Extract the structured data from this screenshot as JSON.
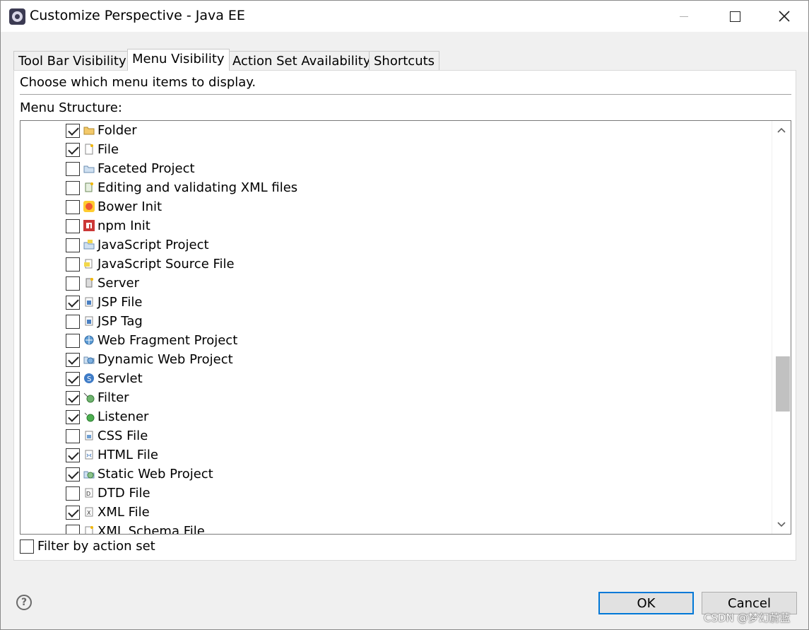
{
  "window": {
    "title": "Customize Perspective - Java EE"
  },
  "tabs": [
    {
      "label": "Tool Bar Visibility",
      "active": false
    },
    {
      "label": "Menu Visibility",
      "active": true
    },
    {
      "label": "Action Set Availability",
      "active": false
    },
    {
      "label": "Shortcuts",
      "active": false
    }
  ],
  "panel": {
    "instructions": "Choose which menu items to display.",
    "tree_label": "Menu Structure:"
  },
  "tree_items": [
    {
      "label": "Folder",
      "checked": true,
      "icon": "folder-icon"
    },
    {
      "label": "File",
      "checked": true,
      "icon": "file-icon"
    },
    {
      "label": "Faceted Project",
      "checked": false,
      "icon": "faceted-project-icon"
    },
    {
      "label": "Editing and validating XML files",
      "checked": false,
      "icon": "xml-project-icon"
    },
    {
      "label": "Bower Init",
      "checked": false,
      "icon": "bower-icon"
    },
    {
      "label": "npm Init",
      "checked": false,
      "icon": "npm-icon"
    },
    {
      "label": "JavaScript Project",
      "checked": false,
      "icon": "javascript-project-icon"
    },
    {
      "label": "JavaScript Source File",
      "checked": false,
      "icon": "javascript-file-icon"
    },
    {
      "label": "Server",
      "checked": false,
      "icon": "server-icon"
    },
    {
      "label": "JSP File",
      "checked": true,
      "icon": "jsp-file-icon"
    },
    {
      "label": "JSP Tag",
      "checked": false,
      "icon": "jsp-tag-icon"
    },
    {
      "label": "Web Fragment Project",
      "checked": false,
      "icon": "web-fragment-icon"
    },
    {
      "label": "Dynamic Web Project",
      "checked": true,
      "icon": "dynamic-web-project-icon"
    },
    {
      "label": "Servlet",
      "checked": true,
      "icon": "servlet-icon"
    },
    {
      "label": "Filter",
      "checked": true,
      "icon": "filter-icon"
    },
    {
      "label": "Listener",
      "checked": true,
      "icon": "listener-icon"
    },
    {
      "label": "CSS File",
      "checked": false,
      "icon": "css-file-icon"
    },
    {
      "label": "HTML File",
      "checked": true,
      "icon": "html-file-icon"
    },
    {
      "label": "Static Web Project",
      "checked": true,
      "icon": "static-web-project-icon"
    },
    {
      "label": "DTD File",
      "checked": false,
      "icon": "dtd-file-icon"
    },
    {
      "label": "XML File",
      "checked": true,
      "icon": "xml-file-icon"
    },
    {
      "label": "XML Schema File",
      "checked": false,
      "icon": "xml-schema-icon"
    }
  ],
  "filter": {
    "label": "Filter by action set",
    "checked": false
  },
  "buttons": {
    "ok": "OK",
    "cancel": "Cancel",
    "help": "?"
  },
  "watermark": "CSDN @梦幻蔚蓝"
}
